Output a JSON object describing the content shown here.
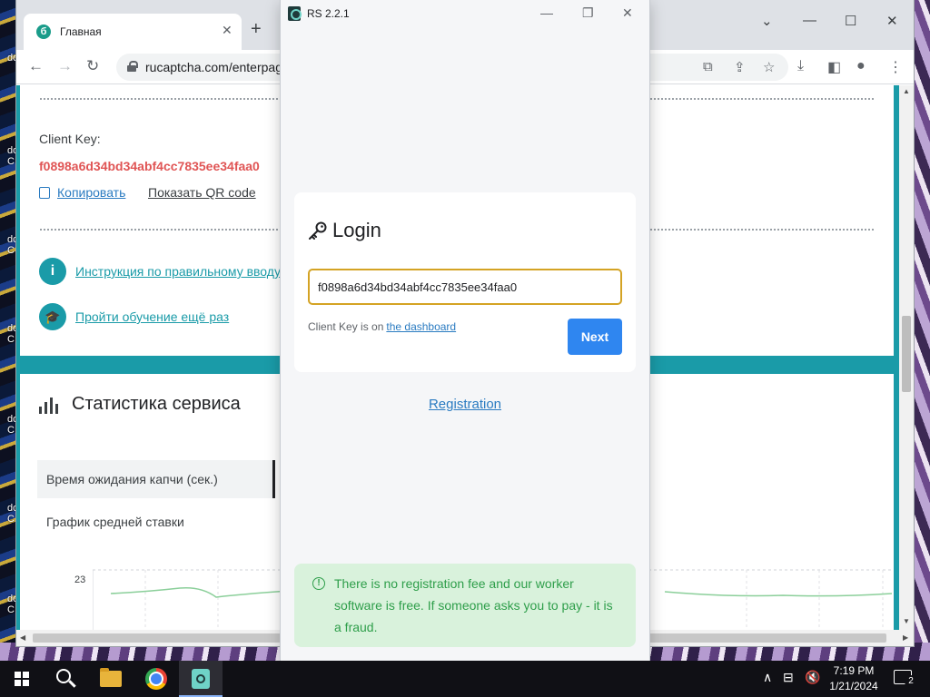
{
  "desktop": {
    "labels": [
      "dc",
      "do\nC",
      "do\nC",
      "do\nC",
      "do\nC",
      "do\nC",
      "do\nC"
    ]
  },
  "browser": {
    "tab_title": "Главная",
    "url": "rucaptcha.com/enterpage",
    "page": {
      "client_key_label": "Client Key:",
      "client_key_value": "f0898a6d34bd34abf4cc7835ee34faa0",
      "copy_link": "Копировать",
      "qr_link": "Показать QR code",
      "instruction_link": "Инструкция по правильному вводу",
      "training_link": "Пройти обучение ещё раз",
      "stats_title": "Статистика сервиса",
      "wait_time_label": "Время ожидания капчи (сек.)",
      "avg_bid_label": "График средней ставки",
      "chart_tick": "23"
    }
  },
  "rs_app": {
    "window_title": "RS 2.2.1",
    "login_title": "Login",
    "client_key_input_value": "f0898a6d34bd34abf4cc7835ee34faa0",
    "hint_text": "Client Key is on",
    "hint_link": "the dashboard",
    "next_button": "Next",
    "registration_link": "Registration",
    "notice": "There is no registration fee and our worker software is free. If someone asks you to pay - it is a fraud."
  },
  "taskbar": {
    "time": "7:19 PM",
    "date": "1/21/2024",
    "notification_count": "2"
  },
  "colors": {
    "accent_teal": "#1a9ba8",
    "client_key_red": "#e05555",
    "input_border": "#d4a324",
    "next_button": "#2f86f0",
    "notice_bg": "#d9f2dc",
    "notice_text": "#2e9e4a"
  }
}
